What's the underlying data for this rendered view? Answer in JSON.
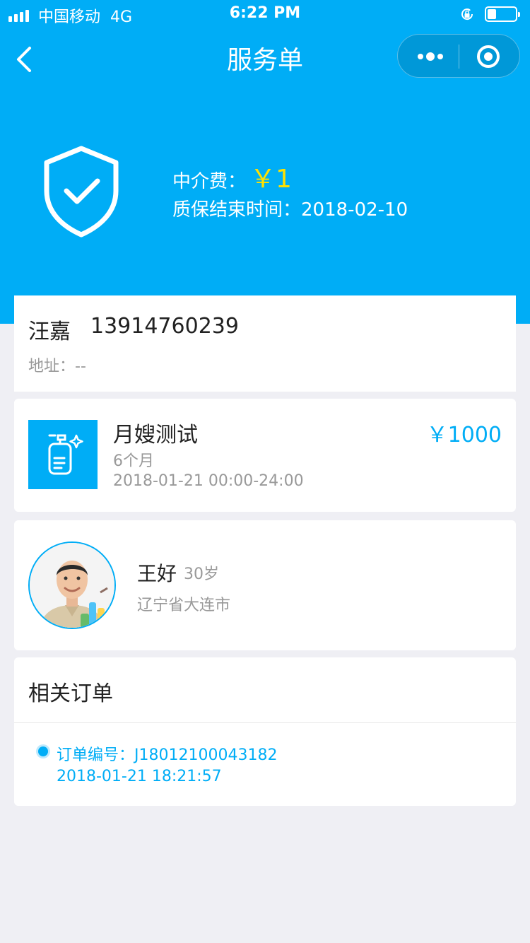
{
  "status_bar": {
    "carrier": "中国移动",
    "network": "4G",
    "time": "6:22 PM"
  },
  "nav": {
    "title": "服务单"
  },
  "hero": {
    "fee_label": "中介费：",
    "fee_value": "￥1",
    "warranty_label": "质保结束时间：",
    "warranty_date": "2018-02-10"
  },
  "customer": {
    "name": "汪嘉",
    "phone": "13914760239",
    "address_label": "地址：",
    "address_value": "--"
  },
  "service": {
    "name": "月嫂测试",
    "duration": "6个月",
    "time_range": "2018-01-21 00:00-24:00",
    "price": "￥1000",
    "icon": "cleaning-spray-icon"
  },
  "worker": {
    "name": "王好",
    "age": "30岁",
    "location": "辽宁省大连市"
  },
  "orders": {
    "title": "相关订单",
    "items": [
      {
        "number_label": "订单编号：",
        "number": "J18012100043182",
        "time": "2018-01-21 18:21:57"
      }
    ]
  },
  "colors": {
    "brand_blue": "#00adf6",
    "fee_yellow": "#ffe100",
    "background": "#efeff4"
  }
}
